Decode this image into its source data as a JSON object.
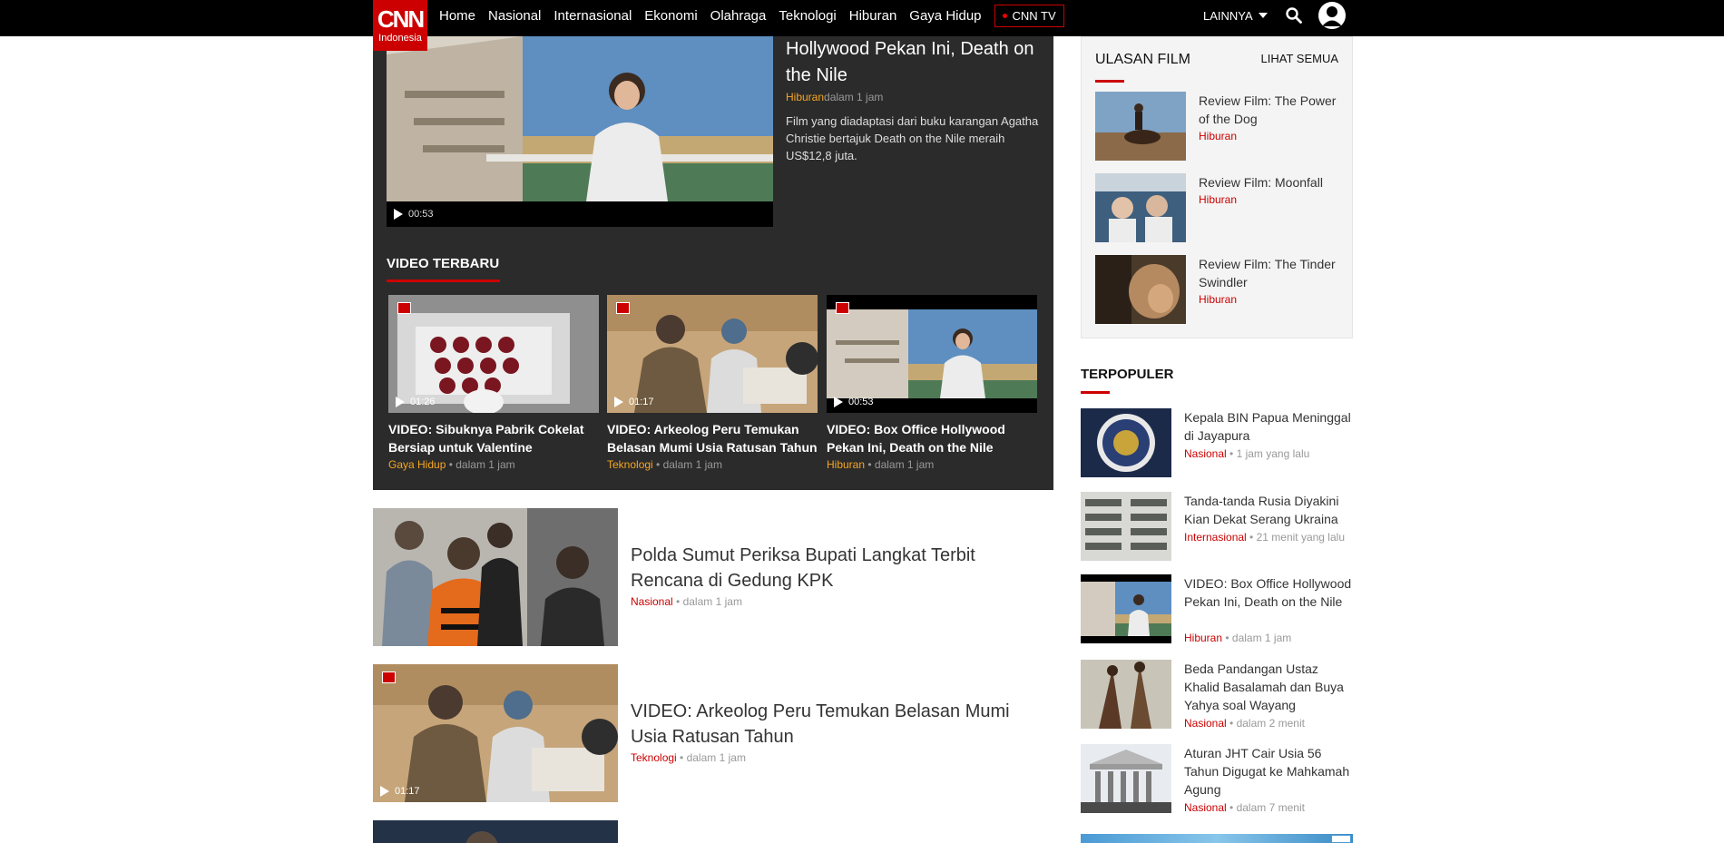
{
  "header": {
    "logo_main": "CNN",
    "logo_sub": "Indonesia",
    "nav": [
      "Home",
      "Nasional",
      "Internasional",
      "Ekonomi",
      "Olahraga",
      "Teknologi",
      "Hiburan",
      "Gaya Hidup"
    ],
    "tv_label": "CNN TV",
    "more_label": "LAINNYA"
  },
  "featured": {
    "title": "Hollywood Pekan Ini, Death on the Nile",
    "category": "Hiburan",
    "time": "dalam 1 jam",
    "description": "Film yang diadaptasi dari buku karangan Agatha Christie bertajuk Death on the Nile meraih US$12,8 juta.",
    "duration": "00:53"
  },
  "video_terbaru": {
    "heading": "VIDEO TERBARU",
    "items": [
      {
        "title": "VIDEO: Sibuknya Pabrik Cokelat Bersiap untuk Valentine",
        "category": "Gaya Hidup",
        "time": "dalam 1 jam",
        "duration": "01:26"
      },
      {
        "title": "VIDEO: Arkeolog Peru Temukan Belasan Mumi Usia Ratusan Tahun",
        "category": "Teknologi",
        "time": "dalam 1 jam",
        "duration": "01:17"
      },
      {
        "title": "VIDEO: Box Office Hollywood Pekan Ini, Death on the Nile",
        "category": "Hiburan",
        "time": "dalam 1 jam",
        "duration": "00:53"
      }
    ]
  },
  "articles": [
    {
      "title": "Polda Sumut Periksa Bupati Langkat Terbit Rencana di Gedung KPK",
      "category": "Nasional",
      "time": "dalam 1 jam"
    },
    {
      "title": "VIDEO: Arkeolog Peru Temukan Belasan Mumi Usia Ratusan Tahun",
      "category": "Teknologi",
      "time": "dalam 1 jam",
      "duration": "01:17"
    }
  ],
  "ulasan_film": {
    "heading": "ULASAN FILM",
    "see_all": "LIHAT SEMUA",
    "items": [
      {
        "title": "Review Film: The Power of the Dog",
        "category": "Hiburan"
      },
      {
        "title": "Review Film: Moonfall",
        "category": "Hiburan"
      },
      {
        "title": "Review Film: The Tinder Swindler",
        "category": "Hiburan"
      }
    ]
  },
  "terpopuler": {
    "heading": "TERPOPULER",
    "items": [
      {
        "title": "Kepala BIN Papua Meninggal di Jayapura",
        "category": "Nasional",
        "time": "1 jam yang lalu"
      },
      {
        "title": "Tanda-tanda Rusia Diyakini Kian Dekat Serang Ukraina",
        "category": "Internasional",
        "time": "21 menit yang lalu"
      },
      {
        "title": "VIDEO: Box Office Hollywood Pekan Ini, Death on the Nile",
        "category": "Hiburan",
        "time": "dalam 1 jam"
      },
      {
        "title": "Beda Pandangan Ustaz Khalid Basalamah dan Buya Yahya soal Wayang",
        "category": "Nasional",
        "time": "dalam 2 menit"
      },
      {
        "title": "Aturan JHT Cair Usia 56 Tahun Digugat ke Mahkamah Agung",
        "category": "Nasional",
        "time": "dalam 7 menit"
      }
    ]
  },
  "colors": {
    "brand": "#cc0000",
    "video_category": "#f5a623",
    "dark_bg": "#2b2b2b"
  }
}
